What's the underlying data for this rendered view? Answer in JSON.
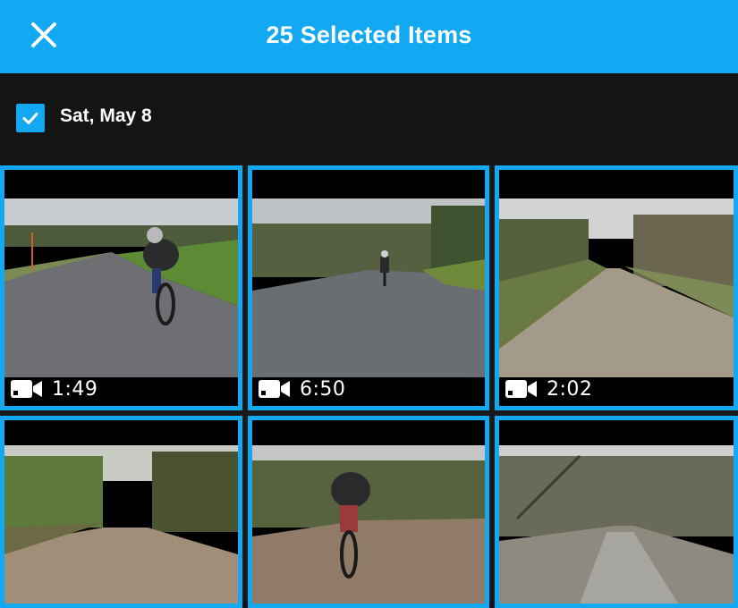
{
  "header": {
    "title": "25 Selected Items",
    "close_icon": "close-icon"
  },
  "group": {
    "date_label": "Sat, May 8",
    "checked": true
  },
  "colors": {
    "accent": "#13a9f2",
    "background": "#121212"
  },
  "media": [
    {
      "type": "video",
      "duration": "1:49",
      "selected": true,
      "scene": "cyclist-paved-road"
    },
    {
      "type": "video",
      "duration": "6:50",
      "selected": true,
      "scene": "cyclist-paved-road-distant"
    },
    {
      "type": "video",
      "duration": "2:02",
      "selected": true,
      "scene": "gravel-road-woods"
    },
    {
      "type": "video",
      "selected": true,
      "scene": "gravel-road-forest"
    },
    {
      "type": "video",
      "selected": true,
      "scene": "cyclist-gravel-road"
    },
    {
      "type": "video",
      "selected": true,
      "scene": "gravel-road-bare-trees"
    }
  ]
}
